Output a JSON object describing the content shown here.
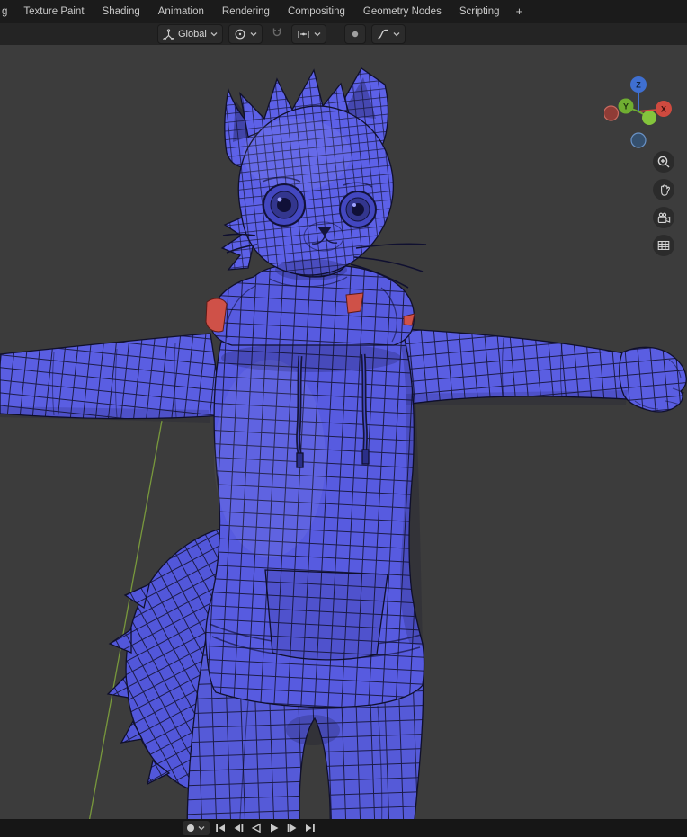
{
  "topbar": {
    "tabs": [
      {
        "label": "g"
      },
      {
        "label": "Texture Paint"
      },
      {
        "label": "Shading"
      },
      {
        "label": "Animation"
      },
      {
        "label": "Rendering"
      },
      {
        "label": "Compositing"
      },
      {
        "label": "Geometry Nodes"
      },
      {
        "label": "Scripting"
      },
      {
        "label": "+"
      }
    ]
  },
  "viewport_header": {
    "orientation_value": "Global",
    "icons": [
      "transform-orientation-icon",
      "snap-target-icon",
      "magnet-snap-icon",
      "snap-increment-icon",
      "proportional-editing-icon",
      "proportional-falloff-icon"
    ]
  },
  "viewport": {
    "gizmo": {
      "z_label": "Z",
      "y_label": "Y",
      "x_label": "X",
      "axis_colors": {
        "x": "#cf4a3f",
        "y": "#6fae31",
        "z": "#3f6fd0"
      }
    },
    "nav_buttons": [
      "zoom-icon",
      "pan-hand-icon",
      "camera-view-icon",
      "grid-view-icon"
    ],
    "model": {
      "body_color": "#575be0",
      "wire_color": "#1c1c48",
      "accent_red": "#cf5148",
      "axis_line_green": "#7fa33c",
      "background": "#3c3c3c"
    }
  },
  "timeline": {
    "autokey_icon": "record-circle-icon",
    "transport": [
      "jump-to-start-icon",
      "previous-frame-icon",
      "play-reverse-icon",
      "play-icon",
      "next-frame-icon",
      "jump-to-end-icon"
    ]
  }
}
